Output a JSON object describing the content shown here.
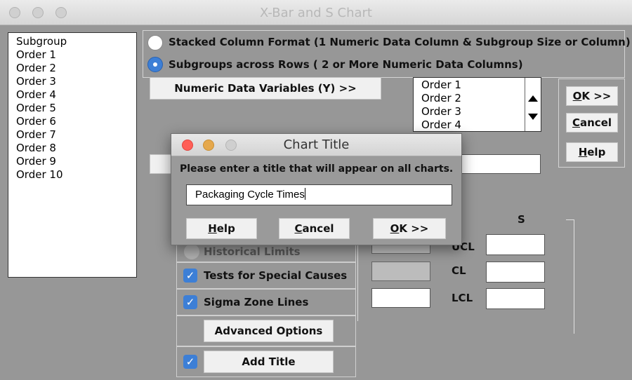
{
  "window": {
    "title": "X-Bar and S Chart"
  },
  "variables_list": [
    "Subgroup",
    "Order 1",
    "Order 2",
    "Order 3",
    "Order 4",
    "Order 5",
    "Order 6",
    "Order 7",
    "Order 8",
    "Order 9",
    "Order 10"
  ],
  "format": {
    "stacked_label": "Stacked Column Format (1 Numeric Data Column & Subgroup Size or Column)",
    "across_rows_label": "Subgroups across Rows ( 2 or More Numeric Data Columns)",
    "selected": "across_rows"
  },
  "numeric_button": {
    "label": "Numeric Data Variables (Y) >>"
  },
  "selected_list": [
    "Order 1",
    "Order 2",
    "Order 3",
    "Order 4"
  ],
  "side_buttons": {
    "ok": "OK >>",
    "cancel": "Cancel",
    "help": "Help"
  },
  "limits": {
    "header": "S",
    "historical_label": "Historical Limits",
    "ucl": "UCL",
    "cl": "CL",
    "lcl": "LCL"
  },
  "options": {
    "tests_label": "Tests for Special Causes",
    "tests_checked": true,
    "sigma_label": "Sigma Zone Lines",
    "sigma_checked": true,
    "advanced_label": "Advanced Options",
    "add_title_label": "Add Title",
    "add_title_checked": true
  },
  "dialog": {
    "title": "Chart Title",
    "prompt": "Please enter a title that will appear on all charts.",
    "input_value": "Packaging Cycle Times",
    "help_label": "Help",
    "cancel_label": "Cancel",
    "ok_label": "OK >>"
  },
  "colors": {
    "accent": "#3d7fd6",
    "background": "#979797",
    "close": "#ff5f57",
    "minimize": "#e5a84c"
  }
}
